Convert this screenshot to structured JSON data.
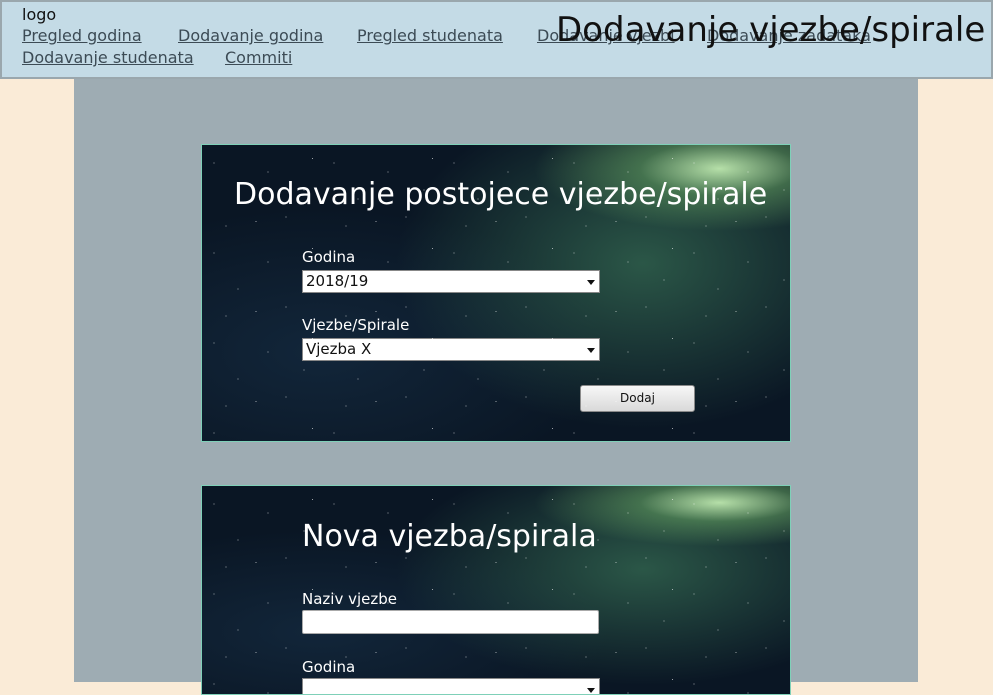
{
  "header": {
    "logo": "logo",
    "title": "Dodavanje vjezbe/spirale",
    "nav": [
      "Pregled godina",
      "Dodavanje godina",
      "Pregled studenata",
      "Dodavanje vjezbi",
      "Dodavanje zadataka",
      "Dodavanje studenata",
      "Commiti"
    ]
  },
  "existing_form": {
    "title": "Dodavanje postojece vjezbe/spirale",
    "year_label": "Godina",
    "year_value": "2018/19",
    "exercise_label": "Vjezbe/Spirale",
    "exercise_value": "Vjezba X",
    "submit_label": "Dodaj"
  },
  "new_form": {
    "title": "Nova vjezba/spirala",
    "name_label": "Naziv vjezbe",
    "name_value": "",
    "year_label": "Godina"
  }
}
